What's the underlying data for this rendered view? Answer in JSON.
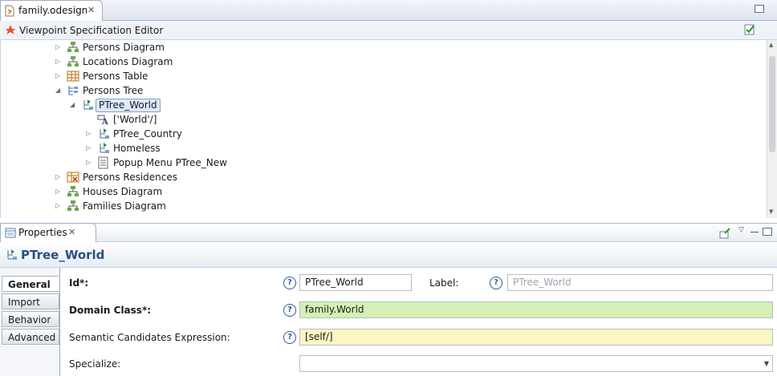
{
  "editor_tab": {
    "title": "family.odesign"
  },
  "editor": {
    "title": "Viewpoint Specification Editor"
  },
  "tree": {
    "items": [
      {
        "label": "Persons Diagram",
        "icon": "diagram-icon",
        "twisty": "collapsed"
      },
      {
        "label": "Locations Diagram",
        "icon": "diagram-icon",
        "twisty": "collapsed"
      },
      {
        "label": "Persons Table",
        "icon": "table-icon",
        "twisty": "collapsed"
      },
      {
        "label": "Persons Tree",
        "icon": "tree-description-icon",
        "twisty": "expanded"
      },
      {
        "label": "PTree_World",
        "icon": "tree-item-icon",
        "twisty": "expanded",
        "selected": true
      },
      {
        "label": "['World'/]",
        "icon": "label-expression-icon",
        "twisty": "none"
      },
      {
        "label": "PTree_Country",
        "icon": "tree-item-icon",
        "twisty": "collapsed"
      },
      {
        "label": "Homeless",
        "icon": "tree-item-icon",
        "twisty": "collapsed"
      },
      {
        "label": "Popup Menu PTree_New",
        "icon": "popup-menu-icon",
        "twisty": "collapsed"
      },
      {
        "label": "Persons Residences",
        "icon": "cross-table-icon",
        "twisty": "collapsed"
      },
      {
        "label": "Houses Diagram",
        "icon": "diagram-icon",
        "twisty": "collapsed"
      },
      {
        "label": "Families Diagram",
        "icon": "diagram-icon",
        "twisty": "collapsed"
      }
    ]
  },
  "properties": {
    "tab_title": "Properties",
    "element_title": "PTree_World",
    "side_tabs": [
      "General",
      "Import",
      "Behavior",
      "Advanced"
    ],
    "fields": {
      "id_label": "Id*:",
      "id_value": "PTree_World",
      "label_label": "Label:",
      "label_placeholder": "PTree_World",
      "domain_class_label": "Domain Class*:",
      "domain_class_value": "family.World",
      "semantic_label": "Semantic Candidates Expression:",
      "semantic_value": "[self/]",
      "specialize_label": "Specialize:",
      "specialize_value": ""
    },
    "help_glyph": "?"
  },
  "colors": {
    "domain_field_bg": "#d5f0b5",
    "semantic_field_bg": "#fdf6c4",
    "title_blue": "#2c4f7c"
  }
}
